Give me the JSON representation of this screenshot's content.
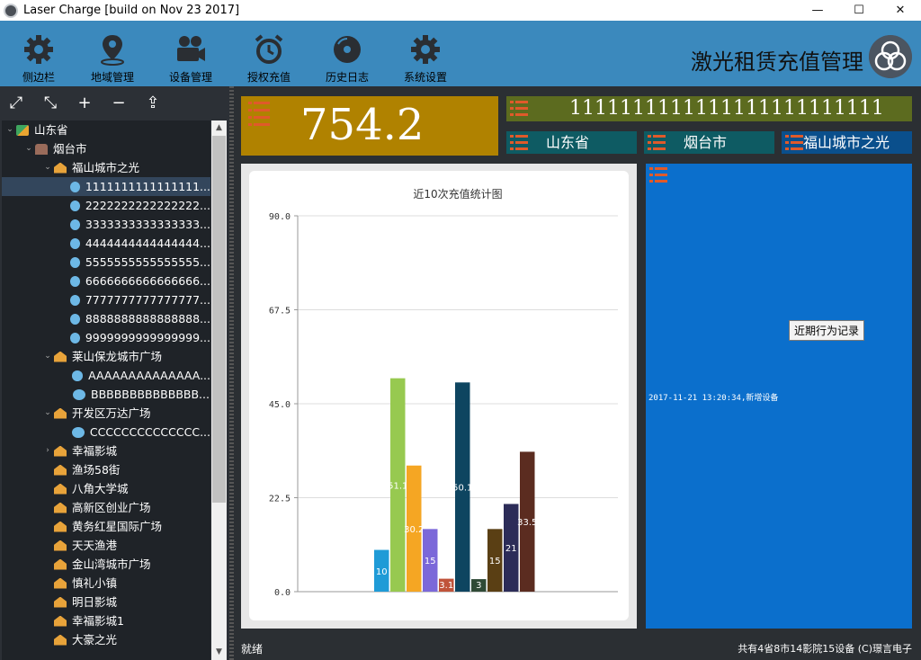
{
  "window": {
    "title": "Laser Charge [build on Nov 23 2017]",
    "min": "—",
    "max": "☐",
    "close": "✕"
  },
  "toolbar": {
    "items": [
      {
        "label": "侧边栏",
        "icon": "gear-icon"
      },
      {
        "label": "地域管理",
        "icon": "map-pin-icon"
      },
      {
        "label": "设备管理",
        "icon": "camera-icon"
      },
      {
        "label": "授权充值",
        "icon": "alarm-clock-icon"
      },
      {
        "label": "历史日志",
        "icon": "disc-icon"
      },
      {
        "label": "系统设置",
        "icon": "settings-icon"
      }
    ],
    "brand": "激光租赁充值管理"
  },
  "tree_tools": [
    "⤢",
    "⤡",
    "+",
    "−",
    "⇪"
  ],
  "tree": [
    {
      "label": "山东省",
      "level": 0,
      "arrow": "⌄",
      "type": "prov"
    },
    {
      "label": "烟台市",
      "level": 1,
      "arrow": "⌄",
      "type": "city"
    },
    {
      "label": "福山城市之光",
      "level": 2,
      "arrow": "⌄",
      "type": "cine"
    },
    {
      "label": "1111111111111111...",
      "level": 3,
      "type": "dev",
      "selected": true
    },
    {
      "label": "2222222222222222...",
      "level": 3,
      "type": "dev"
    },
    {
      "label": "3333333333333333...",
      "level": 3,
      "type": "dev"
    },
    {
      "label": "4444444444444444...",
      "level": 3,
      "type": "dev"
    },
    {
      "label": "5555555555555555...",
      "level": 3,
      "type": "dev"
    },
    {
      "label": "6666666666666666...",
      "level": 3,
      "type": "dev"
    },
    {
      "label": "7777777777777777...",
      "level": 3,
      "type": "dev"
    },
    {
      "label": "8888888888888888...",
      "level": 3,
      "type": "dev"
    },
    {
      "label": "9999999999999999...",
      "level": 3,
      "type": "dev"
    },
    {
      "label": "莱山保龙城市广场",
      "level": 2,
      "arrow": "⌄",
      "type": "cine"
    },
    {
      "label": "AAAAAAAAAAAAAA...",
      "level": 3,
      "type": "dev"
    },
    {
      "label": "BBBBBBBBBBBBBB...",
      "level": 3,
      "type": "dev"
    },
    {
      "label": "开发区万达广场",
      "level": 2,
      "arrow": "⌄",
      "type": "cine"
    },
    {
      "label": "CCCCCCCCCCCCCC...",
      "level": 3,
      "type": "dev"
    },
    {
      "label": "幸福影城",
      "level": 2,
      "arrow": "›",
      "type": "cine"
    },
    {
      "label": "渔场58街",
      "level": 2,
      "type": "cine"
    },
    {
      "label": "八角大学城",
      "level": 2,
      "type": "cine"
    },
    {
      "label": "高新区创业广场",
      "level": 2,
      "type": "cine"
    },
    {
      "label": "黄务红星国际广场",
      "level": 2,
      "type": "cine"
    },
    {
      "label": "天天渔港",
      "level": 2,
      "type": "cine"
    },
    {
      "label": "金山湾城市广场",
      "level": 2,
      "type": "cine"
    },
    {
      "label": "慎礼小镇",
      "level": 2,
      "type": "cine"
    },
    {
      "label": "明日影城",
      "level": 2,
      "type": "cine"
    },
    {
      "label": "幸福影城1",
      "level": 2,
      "type": "cine"
    },
    {
      "label": "大豪之光",
      "level": 2,
      "type": "cine"
    }
  ],
  "panel": {
    "value": "754.2",
    "device_id": "1111111111111111111111111",
    "province": "山东省",
    "city": "烟台市",
    "cinema": "福山城市之光"
  },
  "log": {
    "tooltip": "近期行为记录",
    "entries": [
      "2017-11-21 13:20:34,新增设备"
    ]
  },
  "status": {
    "left": "就绪",
    "right": "共有4省8市14影院15设备 (C)璟言电子"
  },
  "colors": {
    "toolbar": "#3b89bd",
    "value_bg": "#b08200",
    "id_bg": "#5c6b1f",
    "province_bg": "#0e5b63",
    "city_bg": "#0e5b63",
    "cinema_bg": "#0a4f8c",
    "log_bg": "#0b6fcc"
  },
  "chart_data": {
    "type": "bar",
    "title": "近10次充值统计图",
    "ylim": [
      0,
      90
    ],
    "yticks": [
      "0.0",
      "22.5",
      "45.0",
      "67.5",
      "90.0"
    ],
    "values": [
      10,
      51.1,
      30.2,
      15,
      3.1,
      50.1,
      3,
      15,
      21,
      33.5
    ],
    "labels": [
      "10",
      "51.1",
      "30.2",
      "15",
      "3.1",
      "50.1",
      "3",
      "15",
      "21",
      "33.5"
    ],
    "colors": [
      "#1f9bd7",
      "#97c950",
      "#f5a623",
      "#7b68d9",
      "#c0533a",
      "#0e4560",
      "#2f4a36",
      "#5a3f14",
      "#2c2c58",
      "#5b2c20"
    ],
    "grid": true
  }
}
